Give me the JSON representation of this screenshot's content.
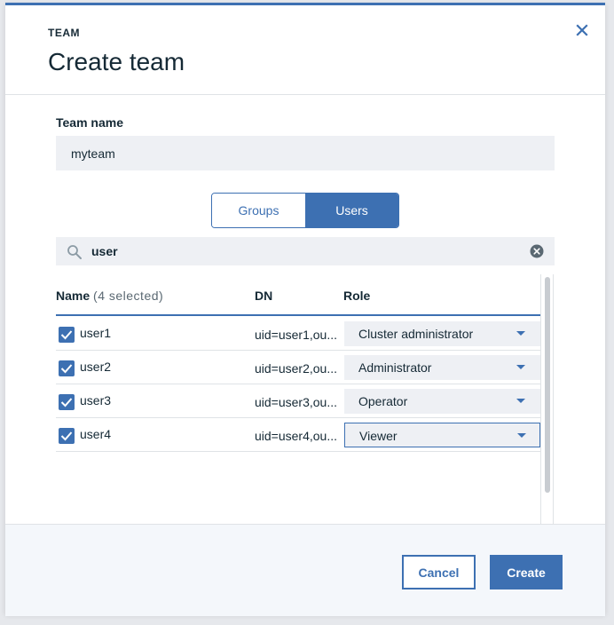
{
  "dialog": {
    "eyebrow": "TEAM",
    "title": "Create team"
  },
  "form": {
    "team_name_label": "Team name",
    "team_name_value": "myteam"
  },
  "toggle": {
    "options": [
      {
        "label": "Groups",
        "selected": false
      },
      {
        "label": "Users",
        "selected": true
      }
    ]
  },
  "search": {
    "value": "user"
  },
  "table": {
    "headers": {
      "name": "Name",
      "selected_count": "(4 selected)",
      "dn": "DN",
      "role": "Role"
    },
    "rows": [
      {
        "checked": true,
        "name": "user1",
        "dn": "uid=user1,ou...",
        "role": "Cluster administrator"
      },
      {
        "checked": true,
        "name": "user2",
        "dn": "uid=user2,ou...",
        "role": "Administrator"
      },
      {
        "checked": true,
        "name": "user3",
        "dn": "uid=user3,ou...",
        "role": "Operator"
      },
      {
        "checked": true,
        "name": "user4",
        "dn": "uid=user4,ou...",
        "role": "Viewer"
      }
    ]
  },
  "footer": {
    "cancel_label": "Cancel",
    "create_label": "Create"
  },
  "colors": {
    "accent": "#3d70b2",
    "field_bg": "#eef0f4",
    "footer_bg": "#f4f7fb",
    "text": "#152935"
  },
  "icons": [
    "close-icon",
    "search-icon",
    "clear-search-icon",
    "checkmark-icon",
    "caret-down-icon"
  ]
}
